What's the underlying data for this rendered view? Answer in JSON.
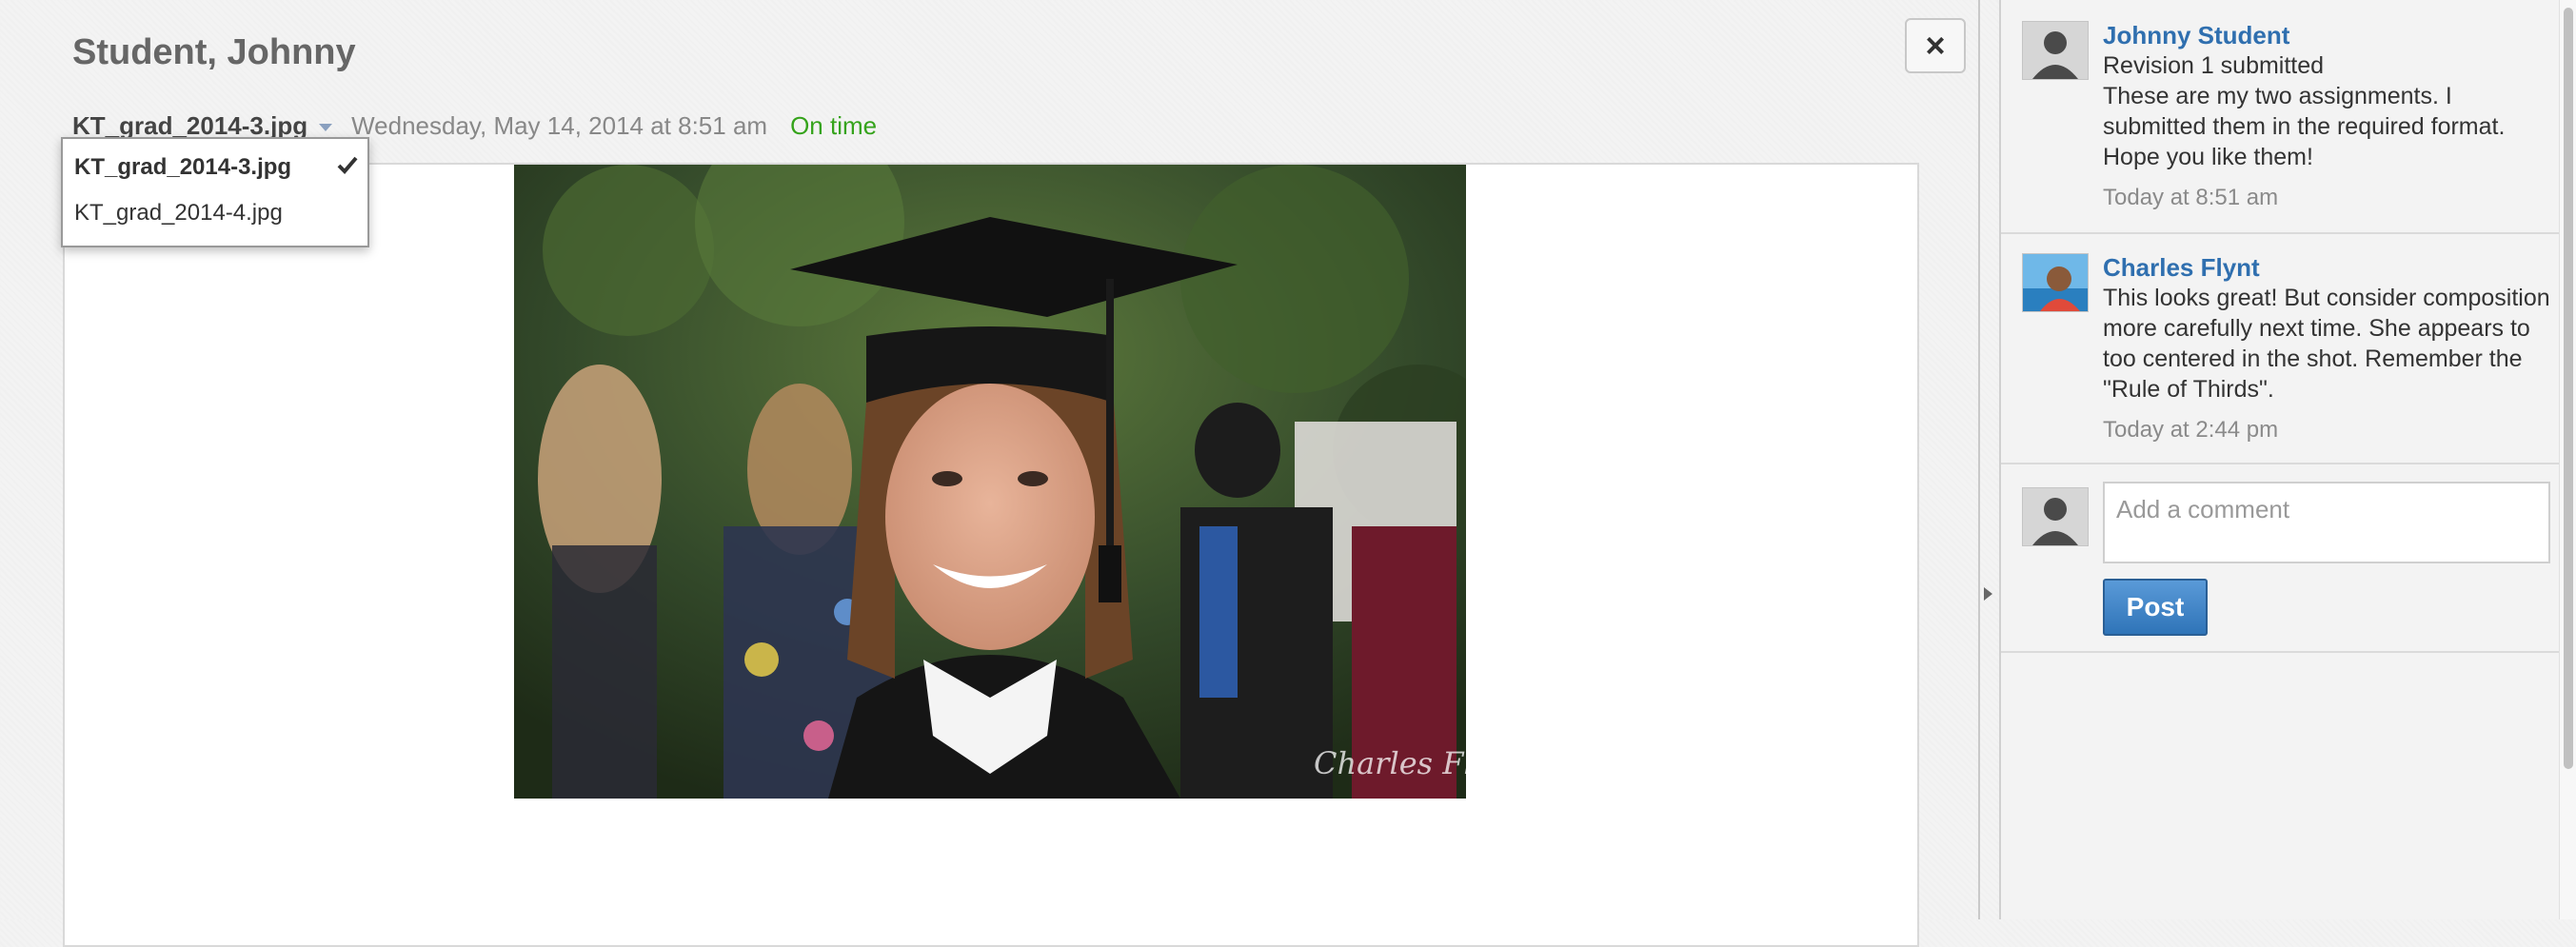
{
  "header": {
    "student_name": "Student, Johnny",
    "selected_file": "KT_grad_2014-3.jpg",
    "submitted_at": "Wednesday, May 14, 2014 at 8:51 am",
    "status": "On time",
    "close_label": "×"
  },
  "file_dropdown": {
    "options": [
      {
        "label": "KT_grad_2014-3.jpg",
        "selected": true
      },
      {
        "label": "KT_grad_2014-4.jpg",
        "selected": false
      }
    ]
  },
  "preview": {
    "watermark": "Charles Flynt"
  },
  "comments": [
    {
      "author": "Johnny Student",
      "revision": "Revision 1 submitted",
      "text": "These are my two assignments. I submitted them in the required format. Hope you like them!",
      "time": "Today at 8:51 am"
    },
    {
      "author": "Charles Flynt",
      "text": "This looks great! But consider composition more carefully next time. She appears to too centered in the shot. Remember the \"Rule of Thirds\".",
      "time": "Today at 2:44 pm"
    }
  ],
  "new_comment": {
    "placeholder": "Add a comment",
    "post_label": "Post"
  },
  "colors": {
    "link_blue": "#2f6faf",
    "status_green": "#35a31b",
    "post_button": "#3d83c6"
  }
}
